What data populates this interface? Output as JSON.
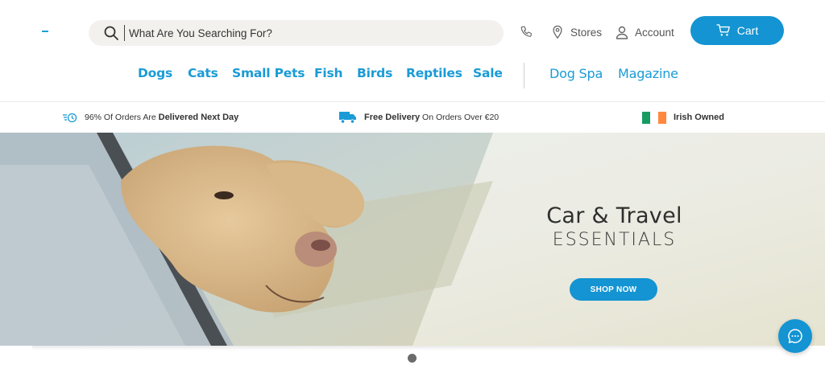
{
  "header": {
    "search": {
      "placeholder": "What Are You Searching For?",
      "icon": "search-icon"
    },
    "utility": {
      "phone_icon": "phone-icon",
      "stores_label": "Stores",
      "account_label": "Account",
      "cart_label": "Cart"
    }
  },
  "nav": {
    "items": [
      {
        "label": "Dogs"
      },
      {
        "label": "Cats"
      },
      {
        "label": "Small Pets"
      },
      {
        "label": "Fish"
      },
      {
        "label": "Birds"
      },
      {
        "label": "Reptiles"
      },
      {
        "label": "Sale"
      },
      {
        "label": "Dog Spa"
      },
      {
        "label": "Magazine"
      }
    ]
  },
  "usp_strip": {
    "delivery_time": {
      "pre": "96% Of Orders Are",
      "bold": "Delivered Next Day",
      "icon": "timer-icon"
    },
    "free_delivery": {
      "bold": "Free Delivery",
      "post": "On Orders Over €20",
      "icon": "truck-icon"
    },
    "irish": {
      "bold": "Irish Owned",
      "icon": "irish-flag-icon"
    }
  },
  "hero": {
    "title": "Car & Travel",
    "subtitle": "ESSENTIALS",
    "cta_label": "SHOP NOW"
  },
  "colors": {
    "brand_blue": "#1494d2",
    "nav_blue": "#1a9bd6",
    "search_bg": "#f3f1ee"
  }
}
